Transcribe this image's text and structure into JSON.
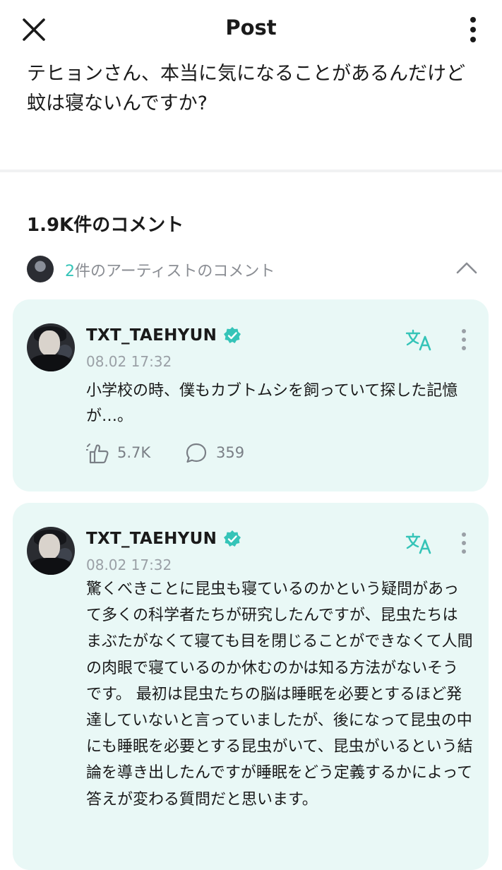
{
  "header": {
    "title": "Post"
  },
  "post": {
    "text": "テヒョンさん、本当に気になることがあるんだけど蚊は寝ないんですか?"
  },
  "comments": {
    "count_label": "1.9K件のコメント",
    "artist_count": "2",
    "artist_label": "件のアーティストのコメント"
  },
  "cards": [
    {
      "author": "TXT_TAEHYUN",
      "timestamp": "08.02 17:32",
      "text": "小学校の時、僕もカブトムシを飼っていて探した記憶が…。",
      "likes": "5.7K",
      "replies": "359"
    },
    {
      "author": "TXT_TAEHYUN",
      "timestamp": "08.02 17:32",
      "text": "驚くべきことに昆虫も寝ているのかという疑問があって多くの科学者たちが研究したんですが、昆虫たちはまぶたがなくて寝ても目を閉じることができなくて人間の肉眼で寝ているのか休むのかは知る方法がないそうです。 最初は昆虫たちの脳は睡眠を必要とするほど発達していないと言っていましたが、後になって昆虫の中にも睡眠を必要とする昆虫がいて、昆虫がいるという結論を導き出したんですが睡眠をどう定義するかによって答えが変わる質問だと思います。"
    }
  ],
  "colors": {
    "accent": "#35c4b8",
    "card_bg": "#e9f8f6",
    "muted": "#9aa0a6"
  },
  "icons": {
    "close": "close-icon",
    "more": "more-vertical-icon",
    "chevron": "chevron-up-icon",
    "verified": "verified-badge-icon",
    "translate": "translate-icon",
    "like": "like-icon",
    "comment": "comment-icon"
  }
}
